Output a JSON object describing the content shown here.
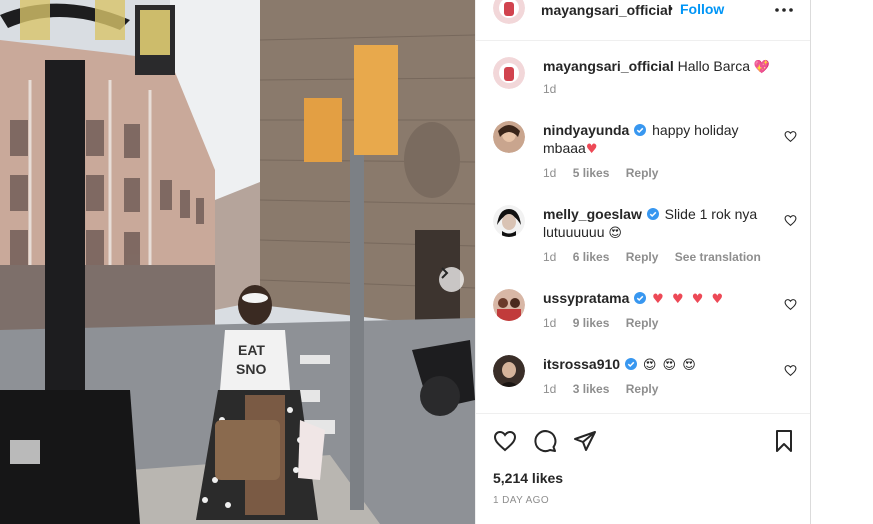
{
  "post": {
    "username": "mayangsari_official",
    "follow_label": "Follow",
    "dot": "•",
    "caption_text": "Hallo Barca",
    "caption_emoji": "💖",
    "caption_time": "1d"
  },
  "comments": [
    {
      "username": "nindyayunda",
      "verified": true,
      "text": "happy holiday mbaaa",
      "emoji": "♥",
      "time": "1d",
      "likes": "5 likes",
      "reply": "Reply",
      "translate": ""
    },
    {
      "username": "melly_goeslaw",
      "verified": true,
      "text": "Slide 1 rok nya lutuuuuuu",
      "emoji": "😍",
      "time": "1d",
      "likes": "6 likes",
      "reply": "Reply",
      "translate": "See translation"
    },
    {
      "username": "ussypratama",
      "verified": true,
      "text": "",
      "emoji": "♥ ♥ ♥ ♥",
      "time": "1d",
      "likes": "9 likes",
      "reply": "Reply",
      "translate": ""
    },
    {
      "username": "itsrossa910",
      "verified": true,
      "text": "",
      "emoji": "😍 😍 😍",
      "time": "1d",
      "likes": "3 likes",
      "reply": "Reply",
      "translate": ""
    }
  ],
  "footer": {
    "likes_count": "5,214 likes",
    "time_ago": "1 DAY AGO"
  },
  "icons": {
    "like": "heart-icon",
    "comment": "comment-icon",
    "share": "paper-plane-icon",
    "save": "bookmark-icon",
    "more": "more-options-icon",
    "next": "chevron-right-icon"
  },
  "colors": {
    "follow_blue": "#0095f6",
    "verified_blue": "#3897f0",
    "heart_red": "#ed4956",
    "muted_text": "#8e8e8e"
  }
}
